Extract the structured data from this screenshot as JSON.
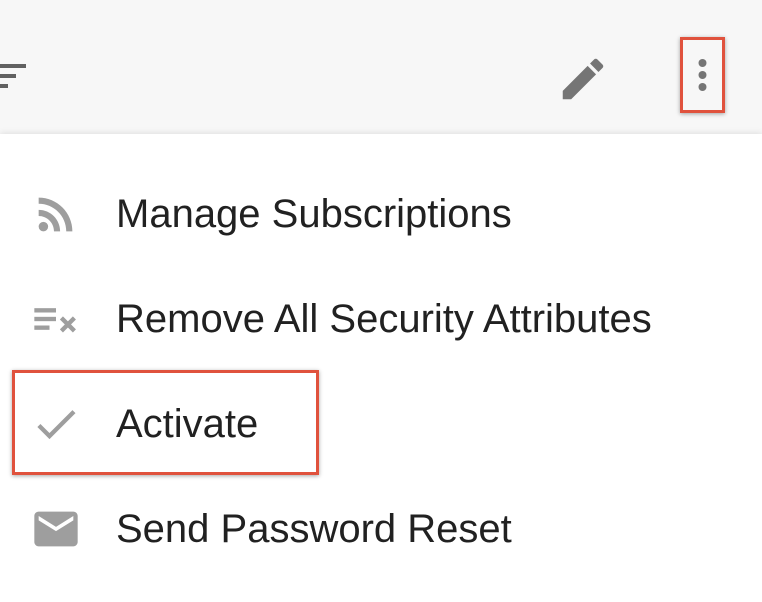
{
  "toolbar": {
    "filter_icon": "filter-list-icon",
    "edit_icon": "pencil-icon",
    "more_icon": "more-vert-icon"
  },
  "menu": {
    "items": [
      {
        "label": "Manage Subscriptions",
        "icon": "rss-feed-icon"
      },
      {
        "label": "Remove All Security Attributes",
        "icon": "clear-all-icon"
      },
      {
        "label": "Activate",
        "icon": "check-icon"
      },
      {
        "label": "Send Password Reset",
        "icon": "mail-icon"
      }
    ]
  },
  "colors": {
    "highlight": "#e0523d",
    "icon": "#9e9e9e",
    "text": "#212121",
    "toolbar_bg": "#f7f7f7"
  }
}
